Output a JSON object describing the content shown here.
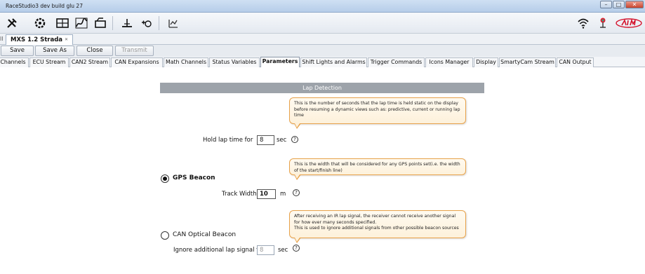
{
  "window": {
    "title": "RaceStudio3 dev build glu 27",
    "controls": {
      "minimize": "–",
      "maximize": "□",
      "close": "✕"
    }
  },
  "toolbar": {
    "icons": [
      "tools-icon",
      "wrench-gear-icon",
      "dashboard-icon",
      "graph-icon",
      "camera-icon",
      "track-icon",
      "gauge-icon",
      "chart-icon",
      "wifi-icon",
      "network-icon",
      "aim-logo"
    ]
  },
  "file_tab": {
    "label": "MXS 1.2 Strada",
    "close_label": "✕"
  },
  "actions": {
    "save": "Save",
    "save_as": "Save As",
    "close": "Close",
    "transmit": "Transmit"
  },
  "tabs": [
    "Channels",
    "ECU Stream",
    "CAN2 Stream",
    "CAN Expansions",
    "Math Channels",
    "Status Variables",
    "Parameters",
    "Shift Lights and Alarms",
    "Trigger Commands",
    "Icons Manager",
    "Display",
    "SmartyCam Stream",
    "CAN Output"
  ],
  "active_tab": "Parameters",
  "lap_detection": {
    "header": "Lap Detection",
    "hold": {
      "tooltip": "This is the number of seconds that the lap time is held static on the display before resuming a dynamic views such as: predictive, current or running lap time",
      "label": "Hold lap time for",
      "value": "8",
      "unit": "sec"
    },
    "gps_beacon": {
      "label": "GPS Beacon",
      "selected": true,
      "tooltip": "This is the width that will be considered for any GPS points set(i.e. the width of the start/finish line)",
      "width_label": "Track Width",
      "width_value": "10",
      "width_unit": "m"
    },
    "can_beacon": {
      "label": "CAN Optical Beacon",
      "selected": false,
      "tooltip_line1": "After receiving an IR lap signal, the receiver cannot receive another signal for how ever many seconds specified.",
      "tooltip_line2": "This is used to ignore additional signals from other possible beacon sources",
      "ignore_label": "Ignore additional lap signal for",
      "ignore_value": "8",
      "ignore_unit": "sec"
    },
    "help_glyph": "?"
  },
  "colors": {
    "header_bg": "#9da3aa",
    "tooltip_border": "#e8a24a",
    "tooltip_bg": "#fdf1db",
    "aim_red": "#d4102a"
  }
}
